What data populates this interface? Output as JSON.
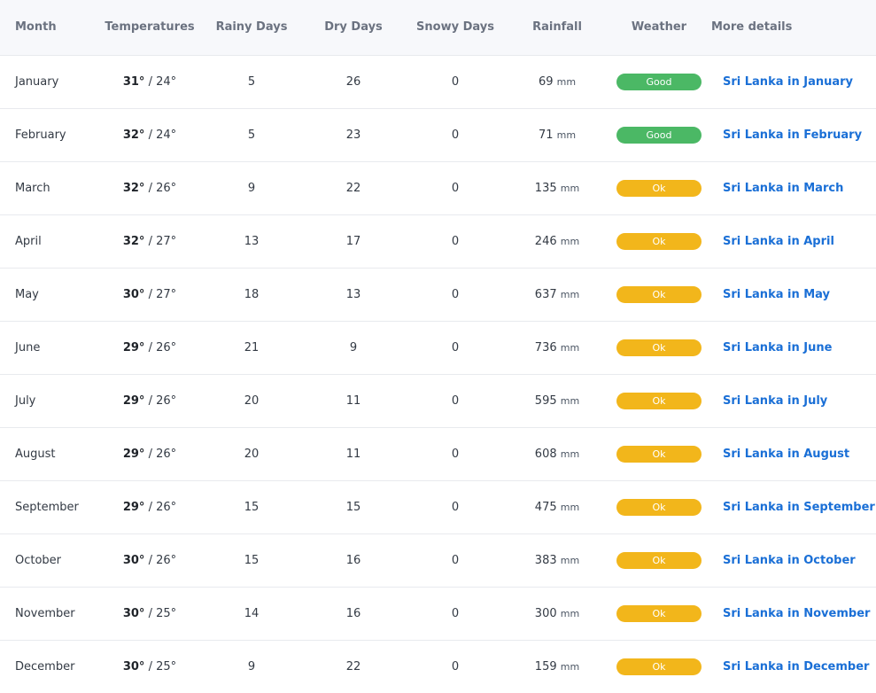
{
  "colors": {
    "good": "#4bb865",
    "ok": "#f2b61b",
    "link": "#1a6fd6"
  },
  "headers": {
    "month": "Month",
    "temperatures": "Temperatures",
    "rainy_days": "Rainy Days",
    "dry_days": "Dry Days",
    "snowy_days": "Snowy Days",
    "rainfall": "Rainfall",
    "weather": "Weather",
    "more_details": "More details"
  },
  "units": {
    "rainfall": "mm"
  },
  "rows": [
    {
      "month": "January",
      "high": "31°",
      "sep": " / ",
      "low": "24°",
      "rainy": "5",
      "dry": "26",
      "snowy": "0",
      "rainfall": "69",
      "weather": "Good",
      "weather_status": "good",
      "link": "Sri Lanka in January"
    },
    {
      "month": "February",
      "high": "32°",
      "sep": " / ",
      "low": "24°",
      "rainy": "5",
      "dry": "23",
      "snowy": "0",
      "rainfall": "71",
      "weather": "Good",
      "weather_status": "good",
      "link": "Sri Lanka in February"
    },
    {
      "month": "March",
      "high": "32°",
      "sep": " / ",
      "low": "26°",
      "rainy": "9",
      "dry": "22",
      "snowy": "0",
      "rainfall": "135",
      "weather": "Ok",
      "weather_status": "ok",
      "link": "Sri Lanka in March"
    },
    {
      "month": "April",
      "high": "32°",
      "sep": " / ",
      "low": "27°",
      "rainy": "13",
      "dry": "17",
      "snowy": "0",
      "rainfall": "246",
      "weather": "Ok",
      "weather_status": "ok",
      "link": "Sri Lanka in April"
    },
    {
      "month": "May",
      "high": "30°",
      "sep": " / ",
      "low": "27°",
      "rainy": "18",
      "dry": "13",
      "snowy": "0",
      "rainfall": "637",
      "weather": "Ok",
      "weather_status": "ok",
      "link": "Sri Lanka in May"
    },
    {
      "month": "June",
      "high": "29°",
      "sep": " / ",
      "low": "26°",
      "rainy": "21",
      "dry": "9",
      "snowy": "0",
      "rainfall": "736",
      "weather": "Ok",
      "weather_status": "ok",
      "link": "Sri Lanka in June"
    },
    {
      "month": "July",
      "high": "29°",
      "sep": " / ",
      "low": "26°",
      "rainy": "20",
      "dry": "11",
      "snowy": "0",
      "rainfall": "595",
      "weather": "Ok",
      "weather_status": "ok",
      "link": "Sri Lanka in July"
    },
    {
      "month": "August",
      "high": "29°",
      "sep": " / ",
      "low": "26°",
      "rainy": "20",
      "dry": "11",
      "snowy": "0",
      "rainfall": "608",
      "weather": "Ok",
      "weather_status": "ok",
      "link": "Sri Lanka in August"
    },
    {
      "month": "September",
      "high": "29°",
      "sep": " / ",
      "low": "26°",
      "rainy": "15",
      "dry": "15",
      "snowy": "0",
      "rainfall": "475",
      "weather": "Ok",
      "weather_status": "ok",
      "link": "Sri Lanka in September"
    },
    {
      "month": "October",
      "high": "30°",
      "sep": " / ",
      "low": "26°",
      "rainy": "15",
      "dry": "16",
      "snowy": "0",
      "rainfall": "383",
      "weather": "Ok",
      "weather_status": "ok",
      "link": "Sri Lanka in October"
    },
    {
      "month": "November",
      "high": "30°",
      "sep": " / ",
      "low": "25°",
      "rainy": "14",
      "dry": "16",
      "snowy": "0",
      "rainfall": "300",
      "weather": "Ok",
      "weather_status": "ok",
      "link": "Sri Lanka in November"
    },
    {
      "month": "December",
      "high": "30°",
      "sep": " / ",
      "low": "25°",
      "rainy": "9",
      "dry": "22",
      "snowy": "0",
      "rainfall": "159",
      "weather": "Ok",
      "weather_status": "ok",
      "link": "Sri Lanka in December"
    }
  ]
}
